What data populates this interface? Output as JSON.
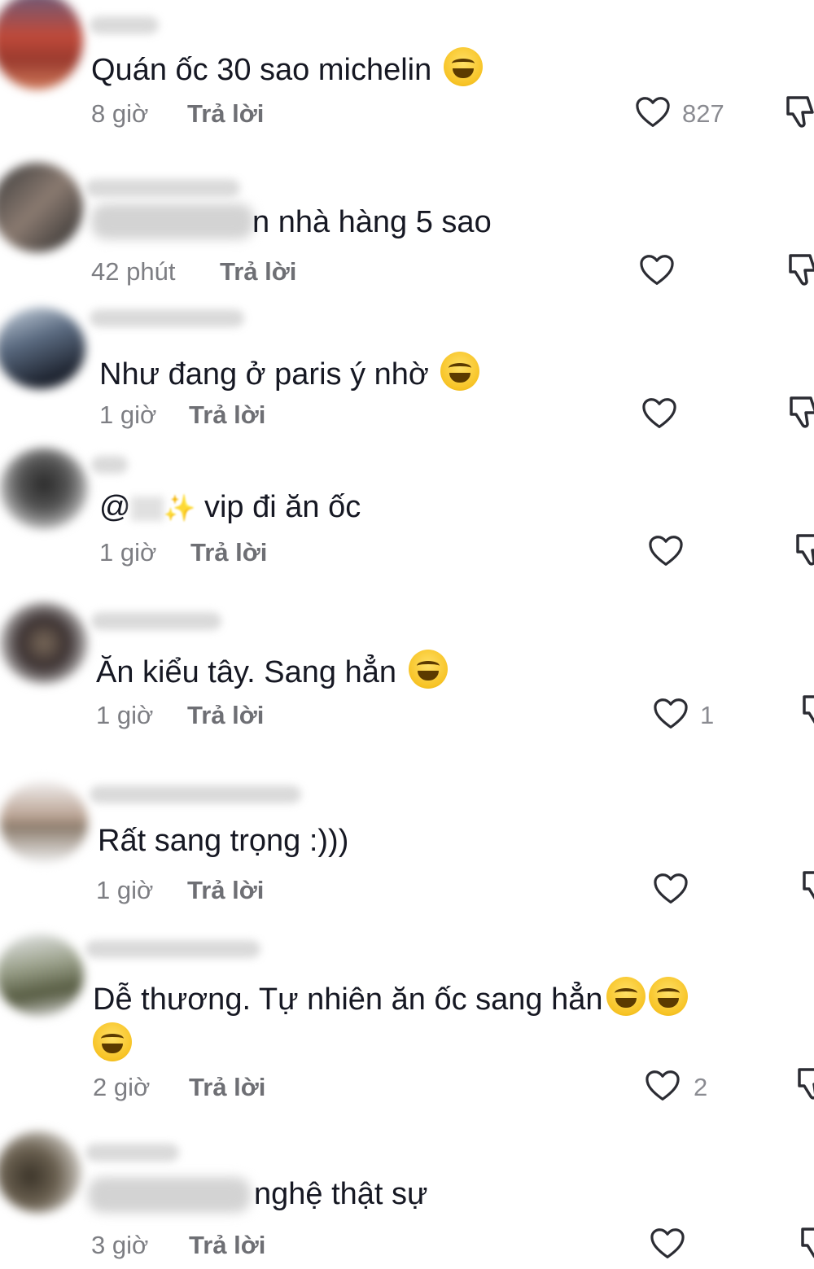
{
  "comments": [
    {
      "text_after_blur": "",
      "text": "Quán ốc 30 sao michelin",
      "emoji": "laugh",
      "time": "8 giờ",
      "reply": "Trả lời",
      "likes": "827"
    },
    {
      "text": "n nhà hàng 5 sao",
      "emoji": "",
      "time": "42 phút",
      "reply": "Trả lời",
      "likes": ""
    },
    {
      "text": "Như đang ở paris ý nhờ",
      "emoji": "grin",
      "time": "1 giờ",
      "reply": "Trả lời",
      "likes": ""
    },
    {
      "text_prefix": "@",
      "text": "vip đi ăn ốc",
      "emoji": "sparkle",
      "time": "1 giờ",
      "reply": "Trả lời",
      "likes": ""
    },
    {
      "text": "Ăn kiểu tây. Sang hẳn",
      "emoji": "laugh",
      "time": "1 giờ",
      "reply": "Trả lời",
      "likes": "1"
    },
    {
      "text": "Rất sang trọng :)))",
      "emoji": "",
      "time": "1 giờ",
      "reply": "Trả lời",
      "likes": ""
    },
    {
      "text": "Dễ thương. Tự nhiên ăn ốc sang hẳn",
      "emoji": "laugh x3",
      "time": "2 giờ",
      "reply": "Trả lời",
      "likes": "2"
    },
    {
      "text": "nghệ thật sự",
      "emoji": "",
      "time": "3 giờ",
      "reply": "Trả lời",
      "likes": ""
    }
  ],
  "icons": {
    "like": "heart-outline-icon",
    "dislike": "thumbs-down-icon",
    "emoji_laugh": "face-with-tears-of-joy",
    "emoji_grin": "grinning-face",
    "sparkle": "sparkles"
  }
}
